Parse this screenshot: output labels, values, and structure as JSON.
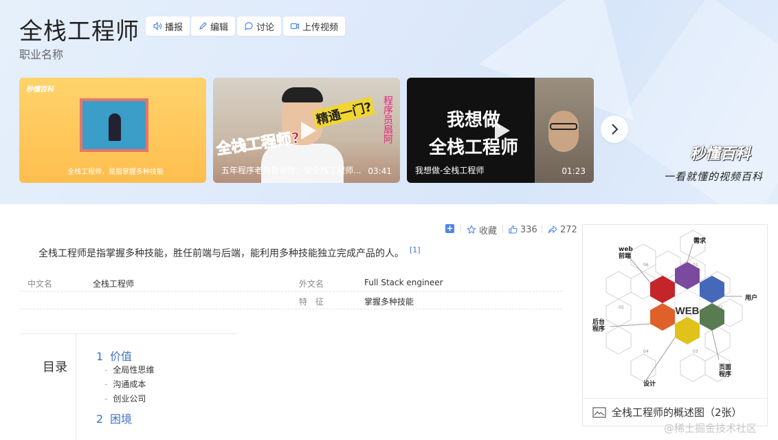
{
  "header": {
    "title": "全栈工程师",
    "subtitle": "职业名称",
    "buttons": [
      {
        "label": "播报",
        "icon": "speaker-icon"
      },
      {
        "label": "编辑",
        "icon": "pencil-icon"
      },
      {
        "label": "讨论",
        "icon": "comment-icon"
      },
      {
        "label": "上传视频",
        "icon": "video-camera-icon"
      }
    ]
  },
  "videos": [
    {
      "logo": "秒懂百科",
      "caption": "全栈工程师，是指掌握多种技能",
      "duration": ""
    },
    {
      "caption": "五年程序老鸟告诉你：做全栈工程师...",
      "duration": "03:41",
      "overlay1": "全栈工程师?",
      "overlay2": "精通一门?",
      "overlay3": "程序员扇阿"
    },
    {
      "caption": "我想做-全栈工程师",
      "duration": "01:23",
      "overlay1": "我想做",
      "overlay2": "全栈工程师"
    }
  ],
  "brand": {
    "name": "秒懂百科",
    "slogan": "一看就懂的视频百科"
  },
  "actions": {
    "collect": "收藏",
    "likes": "336",
    "shares": "272"
  },
  "summary": {
    "text": "全栈工程师是指掌握多种技能，胜任前端与后端，能利用多种技能独立完成产品的人。",
    "ref": "[1]"
  },
  "info": {
    "cn_name_key": "中文名",
    "cn_name_val": "全栈工程师",
    "en_name_key": "外文名",
    "en_name_val": "Full Stack engineer",
    "feature_key": "特　征",
    "feature_val": "掌握多种技能"
  },
  "toc": {
    "title": "目录",
    "sections": [
      {
        "num": "1",
        "label": "价值",
        "subs": [
          "全局性思维",
          "沟通成本",
          "创业公司"
        ]
      },
      {
        "num": "2",
        "label": "困境",
        "subs": []
      }
    ]
  },
  "album": {
    "caption": "全栈工程师的概述图（2张）",
    "center": "WEB",
    "labels": {
      "req": "需求",
      "web": "web\n前端",
      "user": "用户",
      "backend": "后台\n程序",
      "page": "页面\n程序",
      "design": "设计"
    },
    "nums": [
      "01",
      "02",
      "03",
      "04",
      "05",
      "06"
    ],
    "colors": {
      "red": "#c4252b",
      "purple": "#7a4a9e",
      "blue": "#4668b8",
      "orange": "#e0602a",
      "green": "#5a7a52",
      "yellow": "#e0c21a"
    }
  },
  "watermark": "@稀土掘金技术社区"
}
